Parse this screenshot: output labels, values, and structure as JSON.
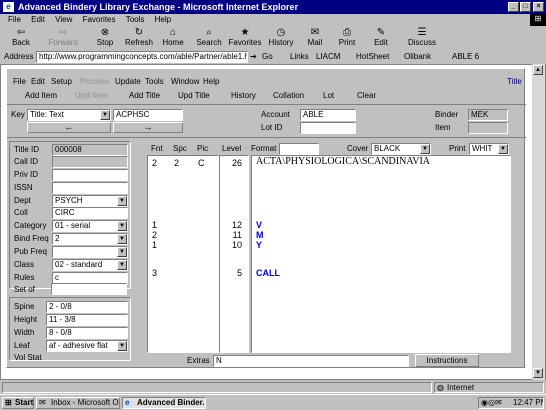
{
  "window": {
    "title": "Advanced Bindery Library Exchange - Microsoft Internet Explorer"
  },
  "ie_menu": [
    "File",
    "Edit",
    "View",
    "Favorites",
    "Tools",
    "Help"
  ],
  "ie_toolbar": [
    "Back",
    "Forward",
    "Stop",
    "Refresh",
    "Home",
    "Search",
    "Favorites",
    "History",
    "Mail",
    "Print",
    "Edit",
    "Discuss"
  ],
  "address": {
    "label": "Address",
    "url": "http://www.programmingconcepts.com/able/Partner/able1.htm",
    "go": "Go",
    "links_label": "Links",
    "links": [
      "LIACM",
      "HotSheet",
      "Olibank",
      "ABLE 6"
    ]
  },
  "app_menu": [
    "File",
    "Edit",
    "Setup",
    "Process",
    "Update",
    "Tools",
    "Window",
    "Help"
  ],
  "app_menu_right": "Title",
  "commands": [
    "Add Item",
    "Upd Item",
    "Add Title",
    "Upd Title",
    "History",
    "Collation",
    "Lot",
    "Clear"
  ],
  "key": {
    "label": "Key",
    "value": "Title: Text",
    "search": "ACPHSC"
  },
  "account": {
    "label": "Account",
    "value": "ABLE"
  },
  "lot_id": {
    "label": "Lot ID",
    "value": ""
  },
  "binder": {
    "label": "Binder",
    "value": "MEK"
  },
  "item": {
    "label": "Item",
    "value": ""
  },
  "title_fields": [
    {
      "label": "Title ID",
      "value": "000008"
    },
    {
      "label": "Call ID",
      "value": ""
    },
    {
      "label": "Priv ID",
      "value": ""
    },
    {
      "label": "ISSN",
      "value": ""
    },
    {
      "label": "Dept",
      "value": "PSYCH"
    },
    {
      "label": "Coll",
      "value": "CIRC"
    },
    {
      "label": "Category",
      "value": "01 - serial"
    },
    {
      "label": "Bind Freq",
      "value": "2"
    },
    {
      "label": "Pub Freq",
      "value": ""
    },
    {
      "label": "Class",
      "value": "02 - standard"
    },
    {
      "label": "Rules",
      "value": "c"
    },
    {
      "label": "Set of",
      "value": ""
    }
  ],
  "spine_fields": [
    {
      "label": "Spine",
      "value": "2 - 0/8"
    },
    {
      "label": "Height",
      "value": "11 - 3/8"
    },
    {
      "label": "Width",
      "value": "8 - 0/8"
    },
    {
      "label": "Leaf",
      "value": "af - adhesive flat"
    },
    {
      "label": "Vol Stat",
      "value": ""
    }
  ],
  "grid": {
    "headers": {
      "fnt": "Fnt",
      "spc": "Spc",
      "pic": "Pic",
      "level": "Level",
      "format": "Format",
      "cover": "Cover",
      "cover_value": "BLACK",
      "print": "Print",
      "print_value": "WHIT"
    },
    "rows": [
      {
        "fnt": "2",
        "spc": "2",
        "pic": "C",
        "level": "26",
        "text": "ACTA\\PHYSIOLOGICA\\SCANDINAVIA",
        "style": "title"
      },
      {
        "fnt": "1",
        "spc": "",
        "pic": "",
        "level": "12",
        "text": "V",
        "style": "blue"
      },
      {
        "fnt": "2",
        "spc": "",
        "pic": "",
        "level": "11",
        "text": "M",
        "style": "blue"
      },
      {
        "fnt": "1",
        "spc": "",
        "pic": "",
        "level": "10",
        "text": "Y",
        "style": "blue"
      },
      {
        "fnt": "3",
        "spc": "",
        "pic": "",
        "level": "5",
        "text": "CALL",
        "style": "blue"
      }
    ]
  },
  "extras": {
    "label": "Extras",
    "value": "N"
  },
  "instructions": "Instructions",
  "status": {
    "zone": "Internet"
  },
  "taskbar": {
    "start": "Start",
    "tasks": [
      "Inbox - Microsoft Out...",
      "Advanced Binder..."
    ],
    "clock": "12:47 PM"
  },
  "colors": {
    "title_bar": "#000080",
    "face": "#c0c0c0",
    "blue_text": "#0000e0"
  }
}
